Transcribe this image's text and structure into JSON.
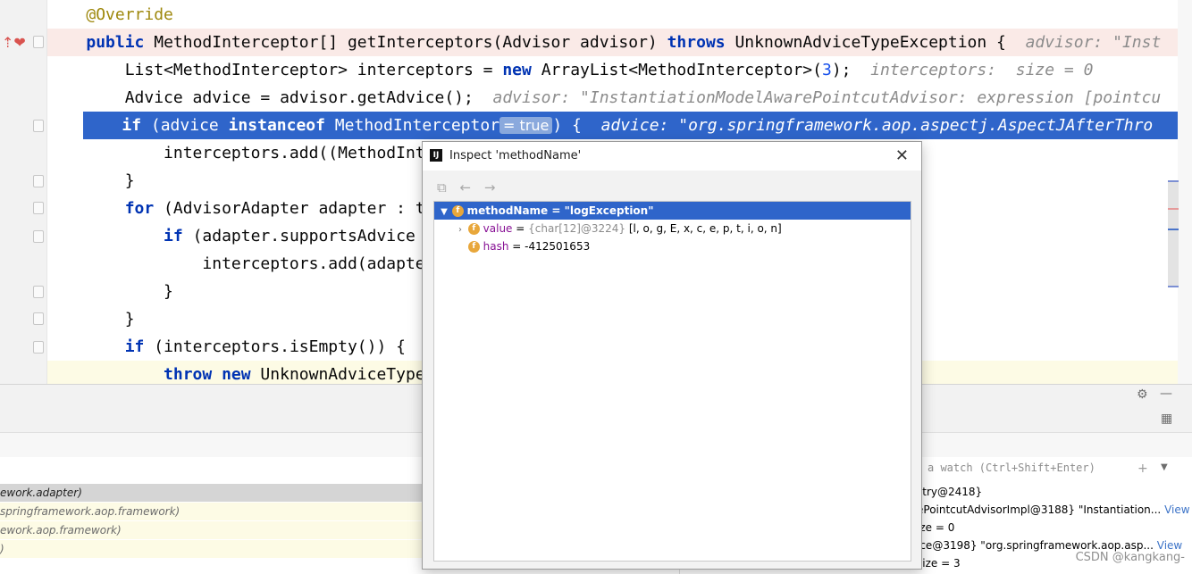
{
  "editor": {
    "lines": [
      {
        "n": 0,
        "segs": [
          {
            "t": "    "
          },
          {
            "t": "@Override",
            "c": "ann"
          }
        ]
      },
      {
        "n": 1,
        "segs": [
          {
            "t": "    "
          },
          {
            "t": "public",
            "c": "kw"
          },
          {
            "t": " MethodInterceptor[] getInterceptors(Advisor advisor) "
          },
          {
            "t": "throws",
            "c": "kw"
          },
          {
            "t": " UnknownAdviceTypeException {  "
          },
          {
            "t": "advisor: \"Inst",
            "c": "hint"
          }
        ]
      },
      {
        "n": 2,
        "segs": [
          {
            "t": "        List<MethodInterceptor> interceptors = "
          },
          {
            "t": "new",
            "c": "kw"
          },
          {
            "t": " ArrayList<MethodInterceptor>("
          },
          {
            "t": "3",
            "c": "num"
          },
          {
            "t": ");  "
          },
          {
            "t": "interceptors:  size = 0",
            "c": "hint"
          }
        ]
      },
      {
        "n": 3,
        "segs": [
          {
            "t": "        Advice advice = advisor.getAdvice();  "
          },
          {
            "t": "advisor: \"InstantiationModelAwarePointcutAdvisor: expression [pointcu",
            "c": "hint"
          }
        ]
      },
      {
        "n": 4,
        "segs": [
          {
            "t": "        "
          },
          {
            "t": "if",
            "c": "kw"
          },
          {
            "t": " (advice "
          },
          {
            "t": "instanceof",
            "c": "kw"
          },
          {
            "t": " MethodInterceptor"
          },
          {
            "t": "= true",
            "c": "tag-true"
          },
          {
            "t": ") {  "
          },
          {
            "t": "advice: \"org.springframework.aop.aspectj.AspectJAfterThro",
            "c": "hint"
          }
        ]
      },
      {
        "n": 5,
        "segs": [
          {
            "t": "            interceptors.add((MethodInt"
          }
        ]
      },
      {
        "n": 6,
        "segs": [
          {
            "t": "        }"
          }
        ]
      },
      {
        "n": 7,
        "segs": [
          {
            "t": "        "
          },
          {
            "t": "for",
            "c": "kw"
          },
          {
            "t": " (AdvisorAdapter adapter : t"
          }
        ]
      },
      {
        "n": 8,
        "segs": [
          {
            "t": "            "
          },
          {
            "t": "if",
            "c": "kw"
          },
          {
            "t": " (adapter.supportsAdvice"
          }
        ]
      },
      {
        "n": 9,
        "segs": [
          {
            "t": "                interceptors.add(adapte"
          }
        ]
      },
      {
        "n": 10,
        "segs": [
          {
            "t": "            }"
          }
        ]
      },
      {
        "n": 11,
        "segs": [
          {
            "t": "        }"
          }
        ]
      },
      {
        "n": 12,
        "segs": [
          {
            "t": "        "
          },
          {
            "t": "if",
            "c": "kw"
          },
          {
            "t": " (interceptors.isEmpty()) {"
          }
        ]
      },
      {
        "n": 13,
        "segs": [
          {
            "t": "            "
          },
          {
            "t": "throw",
            "c": "kw"
          },
          {
            "t": " "
          },
          {
            "t": "new",
            "c": "kw"
          },
          {
            "t": " UnknownAdviceType"
          }
        ]
      }
    ]
  },
  "frames": [
    "ework.adapter)",
    "springframework.aop.framework)",
    "ework.aop.framework)",
    ")"
  ],
  "variables": {
    "watch_placeholder": "a watch (Ctrl+Shift+Enter)",
    "row1": "stry@2418}",
    "row2_a": "ePointcutAdvisorImpl@3188} \"Instantiation...",
    "row2_link": "View",
    "row3": "ize = 0",
    "row4_a": "ice@3198} \"org.springframework.aop.asp...",
    "row4_link": "View",
    "row5": "size = 3"
  },
  "dialog": {
    "title": "Inspect 'methodName'",
    "close": "✕",
    "tree": {
      "root_label": "methodName = \"logException\"",
      "child1_name": "value",
      "child1_eq": " = ",
      "child1_type": "{char[12]@3224}",
      "child1_value": " [l, o, g, E, x, c, e, p, t, i, o, n]",
      "child2_name": "hash",
      "child2_value": " = -412501653"
    }
  },
  "watermark": "CSDN @kangkang-",
  "colors": {
    "selection": "#2f65ca",
    "keyword": "#0033b3",
    "hint": "#8c8c8c",
    "field_badge": "#e8a73b"
  },
  "icons": [
    "breakpoint-icon",
    "settings-icon",
    "minimize-icon",
    "layout-icon",
    "add-watch-icon",
    "dropdown-icon",
    "back-icon",
    "forward-icon",
    "expand-icon"
  ]
}
